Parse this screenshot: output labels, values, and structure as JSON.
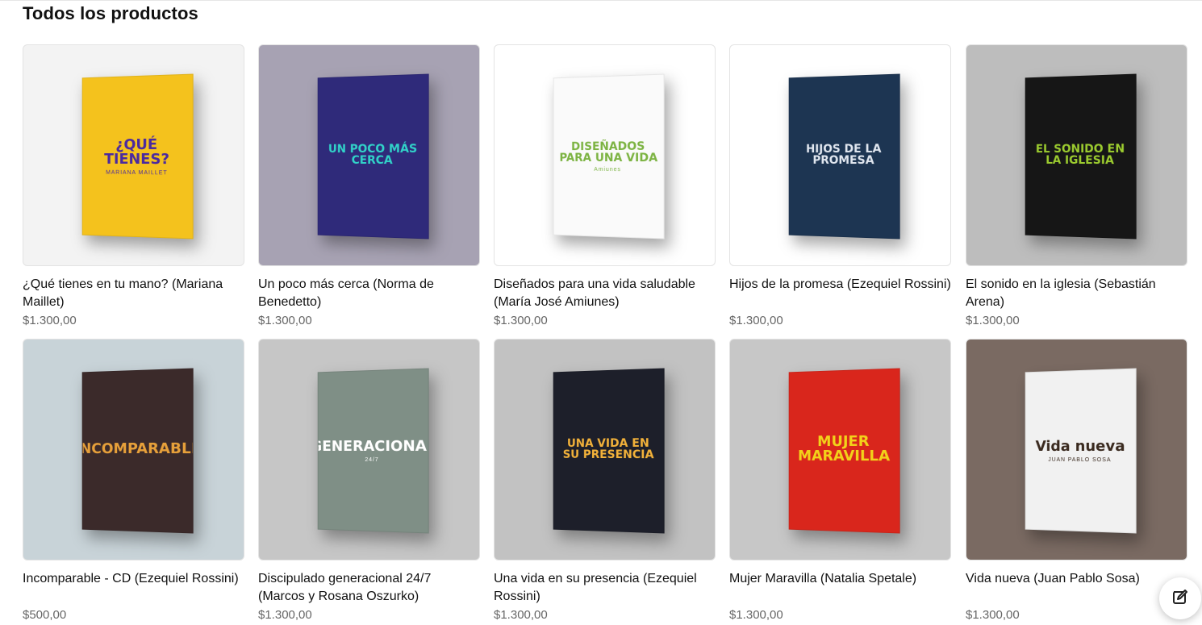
{
  "page": {
    "title": "Todos los productos"
  },
  "products": [
    {
      "title": "¿Qué tienes en tu mano? (Mariana Maillet)",
      "price": "$1.300,00",
      "cover_text": "¿QUÉ TIENES?",
      "cover_sub": "MARIANA MAILLET",
      "bg": "#f3f3f3",
      "cover_color": "#f4c21d",
      "accent": "#4a2aa0"
    },
    {
      "title": "Un poco más cerca (Norma de Benedetto)",
      "price": "$1.300,00",
      "cover_text": "UN POCO MÁS CERCA",
      "cover_sub": "",
      "bg": "#a7a2b3",
      "cover_color": "#2f2a7a",
      "accent": "#31d3c9"
    },
    {
      "title": "Diseñados para una vida saludable (María José Amiunes)",
      "price": "$1.300,00",
      "cover_text": "DISEÑADOS PARA UNA VIDA",
      "cover_sub": "Amiunes",
      "bg": "#ffffff",
      "cover_color": "#fafafa",
      "accent": "#7cb342"
    },
    {
      "title": "Hijos de la promesa (Ezequiel Rossini)",
      "price": "$1.300,00",
      "cover_text": "HIJOS DE LA PROMESA",
      "cover_sub": "",
      "bg": "#ffffff",
      "cover_color": "#1d3552",
      "accent": "#e0e6ef"
    },
    {
      "title": "El sonido en la iglesia (Sebastián Arena)",
      "price": "$1.300,00",
      "cover_text": "EL SONIDO EN LA IGLESIA",
      "cover_sub": "",
      "bg": "#bdbdbd",
      "cover_color": "#161616",
      "accent": "#9ccc2f"
    },
    {
      "title": "Incomparable - CD (Ezequiel Rossini)",
      "price": "$500,00",
      "cover_text": "INCOMPARABLE",
      "cover_sub": "",
      "bg": "#c8d3d8",
      "cover_color": "#3b2a2a",
      "accent": "#e7a03a"
    },
    {
      "title": "Discipulado generacional 24/7 (Marcos y Rosana Oszurko)",
      "price": "$1.300,00",
      "cover_text": "GENERACIONAL",
      "cover_sub": "24/7",
      "bg": "#c6c6c6",
      "cover_color": "#7f8f86",
      "accent": "#ffffff"
    },
    {
      "title": "Una vida en su presencia (Ezequiel Rossini)",
      "price": "$1.300,00",
      "cover_text": "UNA VIDA EN SU PRESENCIA",
      "cover_sub": "",
      "bg": "#c2c2c2",
      "cover_color": "#1d1f2a",
      "accent": "#f3b23a"
    },
    {
      "title": "Mujer Maravilla (Natalia Spetale)",
      "price": "$1.300,00",
      "cover_text": "MUJER MARAVILLA",
      "cover_sub": "",
      "bg": "#c7c7c7",
      "cover_color": "#d9261c",
      "accent": "#f2d21a"
    },
    {
      "title": "Vida nueva (Juan Pablo Sosa)",
      "price": "$1.300,00",
      "cover_text": "Vida nueva",
      "cover_sub": "JUAN PABLO SOSA",
      "bg": "#7a6a62",
      "cover_color": "#f1f1f1",
      "accent": "#3a2a1f"
    }
  ],
  "icons": {
    "edit": "edit-icon"
  }
}
